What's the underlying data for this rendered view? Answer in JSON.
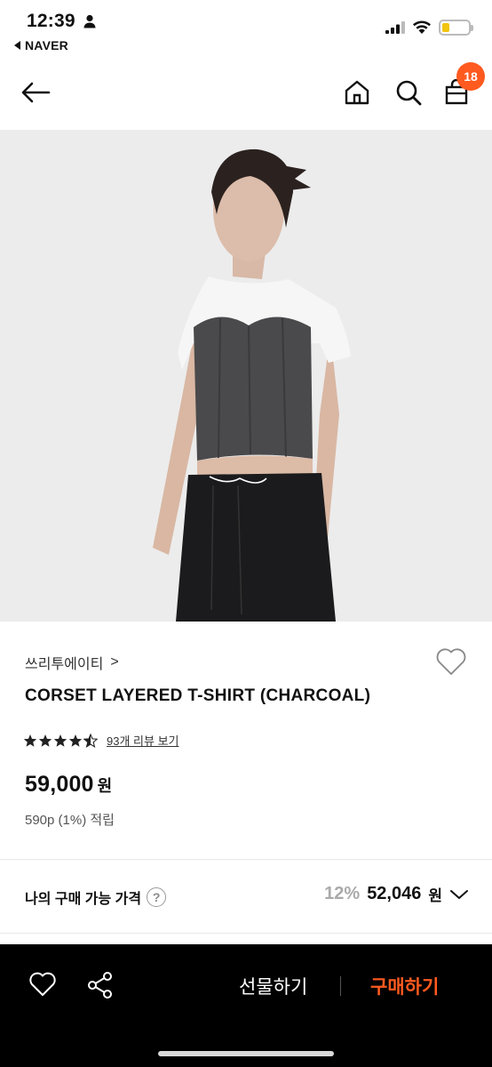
{
  "status_bar": {
    "time": "12:39",
    "back_app": "NAVER",
    "battery_color": "#f1c40f"
  },
  "nav": {
    "cart_count": "18"
  },
  "product": {
    "brand": "쓰리투에이티",
    "brand_chevron": ">",
    "name": "CORSET LAYERED T-SHIRT (CHARCOAL)",
    "rating_stars": 4.5,
    "review_link": "93개 리뷰 보기",
    "price": "59,000",
    "price_unit": "원",
    "points": "590p (1%) 적립"
  },
  "my_price": {
    "label": "나의 구매 가능 가격",
    "help_symbol": "?",
    "discount": "12%",
    "price": "52,046",
    "unit": "원"
  },
  "bottom_bar": {
    "gift_label": "선물하기",
    "buy_label": "구매하기",
    "accent_color": "#ff5a1f"
  }
}
